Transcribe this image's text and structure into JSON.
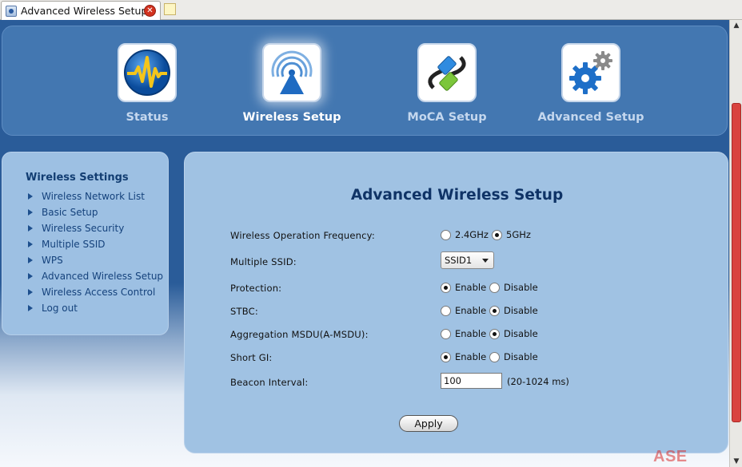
{
  "browser": {
    "tab_title": "Advanced Wireless Setup",
    "close_symbol": "✕"
  },
  "topnav": {
    "items": [
      {
        "label": "Status",
        "icon": "waveform-icon",
        "active": false
      },
      {
        "label": "Wireless Setup",
        "icon": "wireless-signal-icon",
        "active": true
      },
      {
        "label": "MoCA Setup",
        "icon": "cable-connector-icon",
        "active": false
      },
      {
        "label": "Advanced Setup",
        "icon": "gears-icon",
        "active": false
      }
    ]
  },
  "sidebar": {
    "title": "Wireless Settings",
    "items": [
      {
        "label": "Wireless Network List"
      },
      {
        "label": "Basic Setup"
      },
      {
        "label": "Wireless Security"
      },
      {
        "label": "Multiple SSID"
      },
      {
        "label": "WPS"
      },
      {
        "label": "Advanced Wireless Setup"
      },
      {
        "label": "Wireless Access Control"
      },
      {
        "label": "Log out"
      }
    ]
  },
  "main": {
    "title": "Advanced Wireless Setup",
    "frequency": {
      "label": "Wireless Operation Frequency:",
      "opt1": "2.4GHz",
      "opt2": "5GHz",
      "selected": "5GHz"
    },
    "ssid": {
      "label": "Multiple SSID:",
      "value": "SSID1"
    },
    "protection": {
      "label": "Protection:",
      "opt1": "Enable",
      "opt2": "Disable",
      "selected": "Enable"
    },
    "stbc": {
      "label": "STBC:",
      "opt1": "Enable",
      "opt2": "Disable",
      "selected": "Disable"
    },
    "amsdu": {
      "label": "Aggregation MSDU(A-MSDU):",
      "opt1": "Enable",
      "opt2": "Disable",
      "selected": "Disable"
    },
    "shortgi": {
      "label": "Short GI:",
      "opt1": "Enable",
      "opt2": "Disable",
      "selected": "Enable"
    },
    "beacon": {
      "label": "Beacon Interval:",
      "value": "100",
      "hint": "(20-1024 ms)"
    },
    "apply_label": "Apply"
  },
  "watermark": "ASE Labs",
  "colors": {
    "page_bg": "#2a5c99",
    "nav_panel": "#4377b1",
    "panel": "#a0c2e3",
    "title": "#0f3366",
    "scroll_thumb": "#d9433f"
  }
}
